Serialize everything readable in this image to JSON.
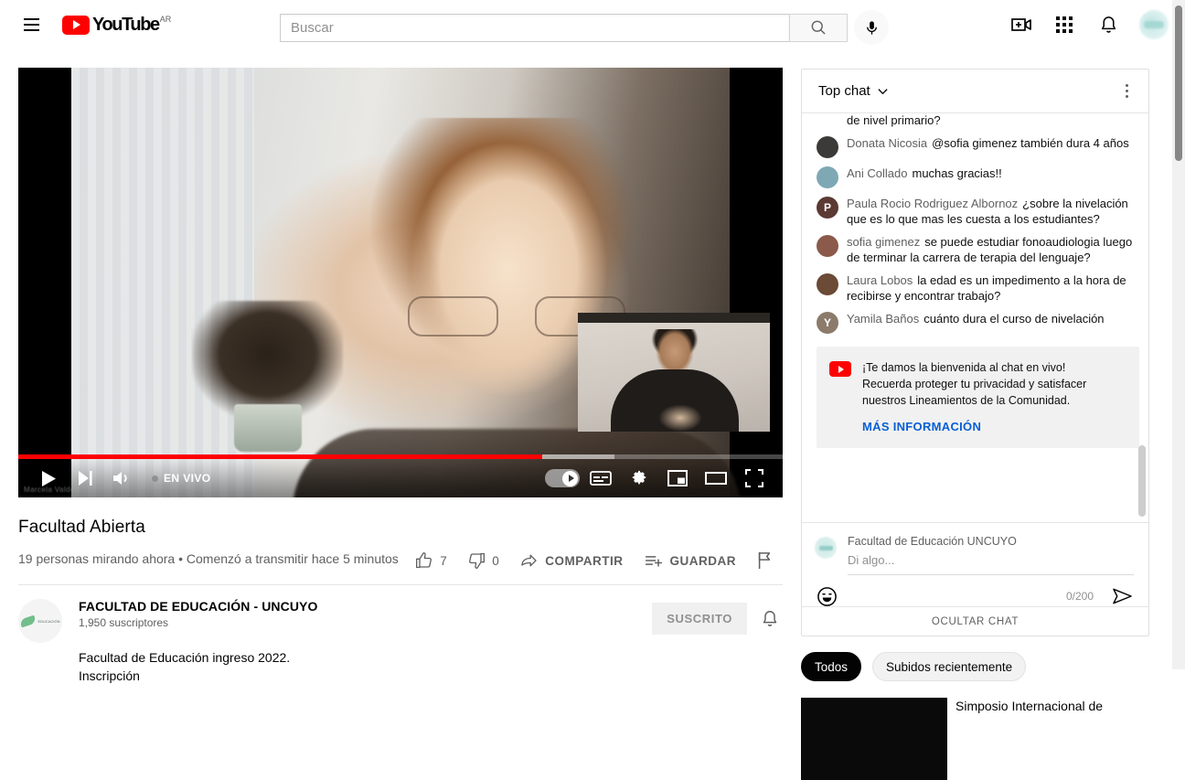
{
  "masthead": {
    "logo_text": "YouTube",
    "logo_country": "AR",
    "search_placeholder": "Buscar",
    "search_value": "",
    "icons": {
      "menu": "hamburger-menu-icon",
      "search": "search-icon",
      "mic": "microphone-icon",
      "create": "create-video-icon",
      "apps": "apps-grid-icon",
      "notifications": "notification-bell-icon",
      "avatar": "account-avatar"
    }
  },
  "player": {
    "live_label": "EN VIVO",
    "progress_percent": 68.5,
    "buffered_percent": 78,
    "watermark": "Marcela Valdez",
    "controls": {
      "play": "play-icon",
      "next": "next-video-icon",
      "volume": "volume-icon",
      "autoplay": "autoplay-toggle",
      "subtitles": "subtitles-icon",
      "settings": "settings-gear-icon",
      "miniplayer": "miniplayer-icon",
      "theater": "theater-mode-icon",
      "fullscreen": "fullscreen-icon"
    }
  },
  "video": {
    "title": "Facultad Abierta",
    "meta": "19 personas mirando ahora • Comenzó a transmitir hace 5 minutos",
    "actions": {
      "like_count": "7",
      "dislike_count": "0",
      "share_label": "COMPARTIR",
      "save_label": "GUARDAR",
      "report_label": "report-flag-icon"
    }
  },
  "channel": {
    "name": "FACULTAD DE EDUCACIÓN - UNCUYO",
    "subscribers": "1,950 suscriptores",
    "subscribe_label": "SUSCRITO",
    "bell_label": "notification-bell-icon",
    "description_line1": "Facultad de Educación ingreso 2022.",
    "description_line2": "Inscripción"
  },
  "chat": {
    "mode_label": "Top chat",
    "messages": [
      {
        "author": "",
        "text": "inscribirme en la carrera de profesorado universitario de nivel primario?",
        "avatar_initial": "",
        "avatar_color": "#bdbdbd",
        "clipped": true
      },
      {
        "author": "Donata Nicosia",
        "text": "@sofia gimenez también dura 4 años",
        "avatar_initial": "",
        "avatar_color": "#3b3a38",
        "clipped": false
      },
      {
        "author": "Ani Collado",
        "text": "muchas gracias!!",
        "avatar_initial": "",
        "avatar_color": "#7fa8b5",
        "clipped": false
      },
      {
        "author": "Paula Rocio Rodriguez Albornoz",
        "text": "¿sobre la nivelación que es lo que mas les cuesta a los estudiantes?",
        "avatar_initial": "P",
        "avatar_color": "#5c3a33",
        "clipped": false
      },
      {
        "author": "sofia gimenez",
        "text": "se puede estudiar fonoaudiologia luego de terminar la carrera de terapia del lenguaje?",
        "avatar_initial": "",
        "avatar_color": "#8b5a4a",
        "clipped": false
      },
      {
        "author": "Laura Lobos",
        "text": "la edad es un impedimento a la hora de recibirse y encontrar trabajo?",
        "avatar_initial": "",
        "avatar_color": "#6b4a36",
        "clipped": false
      },
      {
        "author": "Yamila Baños",
        "text": "cuánto dura el curso de nivelación",
        "avatar_initial": "Y",
        "avatar_color": "#8c7b6b",
        "clipped": false
      }
    ],
    "welcome": {
      "line1": "¡Te damos la bienvenida al chat en vivo!",
      "line2": "Recuerda proteger tu privacidad y satisfacer",
      "line3": "nuestros Lineamientos de la Comunidad.",
      "link": "MÁS INFORMACIÓN"
    },
    "input": {
      "account_name": "Facultad de Educación UNCUYO",
      "placeholder": "Di algo...",
      "value": "",
      "counter": "0/200",
      "emoji_icon": "emoji-smiley-icon",
      "send_icon": "send-arrow-icon"
    },
    "hide_chat_label": "OCULTAR CHAT"
  },
  "suggestions": {
    "chips": [
      {
        "label": "Todos",
        "active": true
      },
      {
        "label": "Subidos recientemente",
        "active": false
      }
    ],
    "items": [
      {
        "title": "Simposio Internacional de"
      }
    ]
  }
}
